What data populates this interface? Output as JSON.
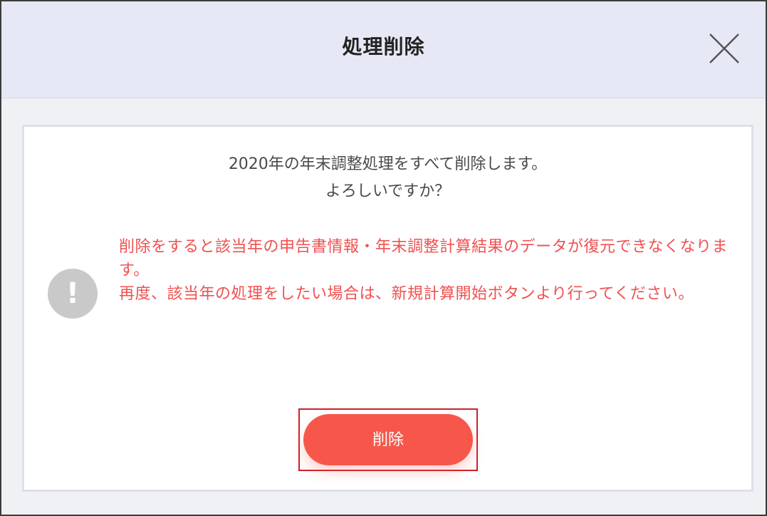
{
  "dialog": {
    "title": "処理削除",
    "close_icon": "close-icon"
  },
  "message": {
    "line1": "2020年の年末調整処理をすべて削除します。",
    "line2": "よろしいですか？"
  },
  "warning": {
    "icon": "exclamation-icon",
    "icon_glyph": "!",
    "paragraph1": "削除をすると該当年の申告書情報・年末調整計算結果のデータが復元できなくなります。",
    "paragraph2": "再度、該当年の処理をしたい場合は、新規計算開始ボタンより行ってください。"
  },
  "actions": {
    "delete_label": "削除"
  },
  "colors": {
    "header_bg": "#e6e9f5",
    "warning_text": "#f05050",
    "delete_button": "#f7574a",
    "highlight_border": "#d0202a",
    "icon_gray": "#c9c9c9"
  }
}
